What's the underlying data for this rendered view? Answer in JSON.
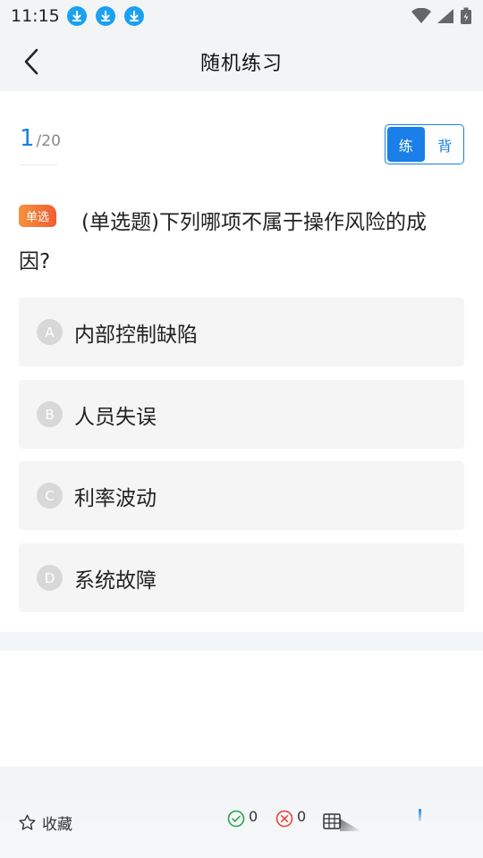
{
  "status_bar": {
    "time": "11:15",
    "download_icon_count": 3
  },
  "nav": {
    "title": "随机练习"
  },
  "progress": {
    "current": "1",
    "separator": "/",
    "total": "20"
  },
  "mode_toggle": {
    "practice_label": "练",
    "recite_label": "背",
    "active": "practice"
  },
  "question": {
    "type_badge": "单选",
    "text": "(单选题)下列哪项不属于操作风险的成因?"
  },
  "options": [
    {
      "letter": "A",
      "text": "内部控制缺陷"
    },
    {
      "letter": "B",
      "text": "人员失误"
    },
    {
      "letter": "C",
      "text": "利率波动"
    },
    {
      "letter": "D",
      "text": "系统故障"
    }
  ],
  "bottom_bar": {
    "favorite_label": "收藏",
    "correct_count": "0",
    "wrong_count": "0"
  },
  "colors": {
    "accent": "#1a7fe8",
    "badge_start": "#f5913d",
    "badge_end": "#ef5d34",
    "correct": "#2aa44a",
    "wrong": "#e8453c",
    "download": "#1aa1f0"
  },
  "icons": {
    "back": "chevron-left-icon",
    "favorite": "star-outline-icon",
    "correct": "check-circle-icon",
    "wrong": "x-circle-icon",
    "answer_card": "grid-icon"
  }
}
